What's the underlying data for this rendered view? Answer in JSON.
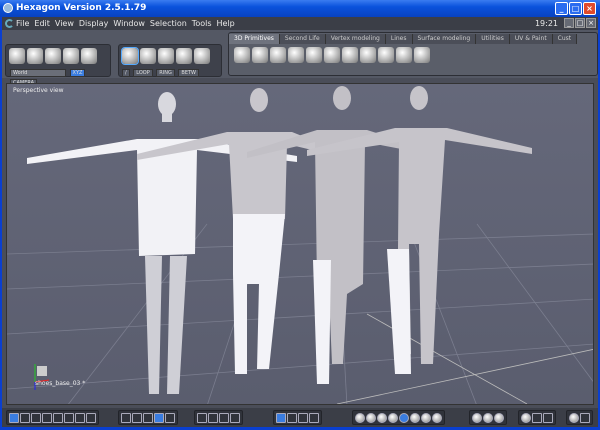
{
  "window": {
    "title": "Hexagon Version 2.5.1.79",
    "clock": "19:21"
  },
  "menu": [
    "File",
    "Edit",
    "View",
    "Display",
    "Window",
    "Selection",
    "Tools",
    "Help"
  ],
  "toolbar": {
    "coord_select": "World",
    "xyz_label": "XYZ",
    "camera_label": "CAMERA",
    "loop_label": "LOOP",
    "ring_label": "RING",
    "betw_label": "BETW"
  },
  "tabs": [
    "3D Primitives",
    "Second Life",
    "Vertex modeling",
    "Lines",
    "Surface modeling",
    "Utilities",
    "UV & Paint",
    "Cust"
  ],
  "viewport": {
    "label": "Perspective view",
    "object_label": "shoes_base_03 *"
  },
  "colors": {
    "titlebar": "#0a52dc",
    "viewport": "#5f6273",
    "accent": "#3a7de0"
  }
}
